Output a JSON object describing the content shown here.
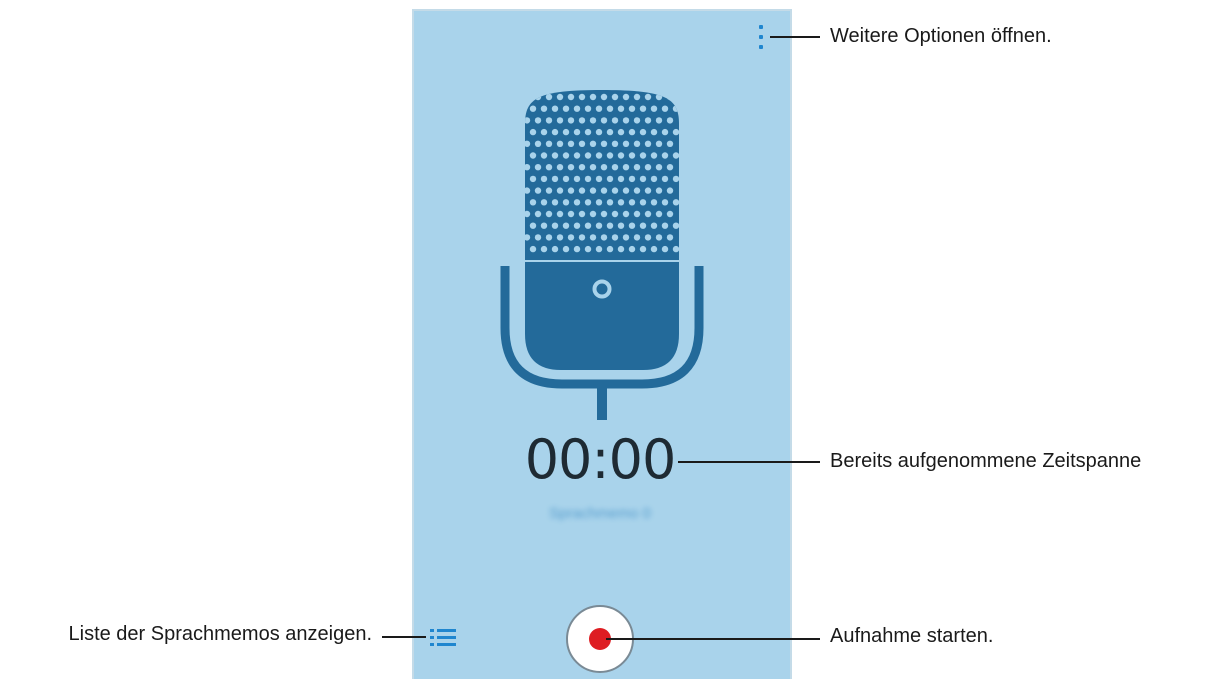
{
  "screen": {
    "timer": "00:00",
    "memo_name": "Sprachmemo 0",
    "icons": {
      "more_options": "more-vertical-icon",
      "microphone": "microphone-icon",
      "list": "list-icon",
      "record": "record-icon"
    },
    "colors": {
      "background": "#a9d3eb",
      "mic_dark": "#236a9a",
      "accent": "#1f86cf",
      "record_dot": "#de1d22"
    }
  },
  "callouts": {
    "more_options": "Weitere Optionen öffnen.",
    "elapsed_time": "Bereits aufgenommene Zeitspanne",
    "record": "Aufnahme starten.",
    "list": "Liste der Sprachmemos anzeigen."
  }
}
